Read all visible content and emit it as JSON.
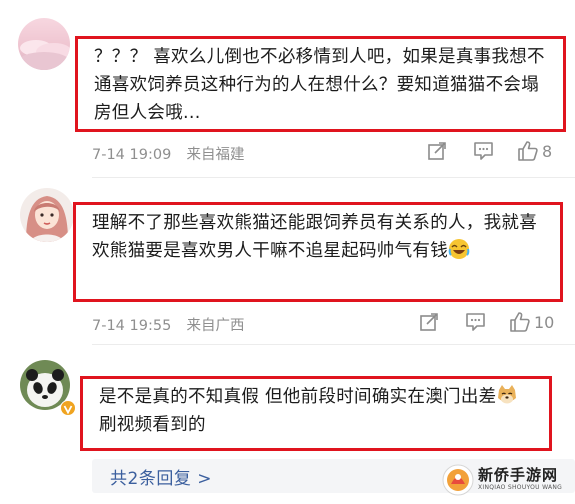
{
  "comments": [
    {
      "text": "？？？ 喜欢么儿倒也不必移情到人吧，如果是真事我想不通喜欢饲养员这种行为的人在想什么？要知道猫猫不会塌房但人会哦...",
      "time": "7-14 19:09",
      "location": "来自福建",
      "likes": "8"
    },
    {
      "text": "理解不了那些喜欢熊猫还能跟饲养员有关系的人，我就喜欢熊猫要是喜欢男人干嘛不追星起码帅气有钱",
      "time": "7-14 19:55",
      "location": "来自广西",
      "likes": "10"
    },
    {
      "text_part1": "是不是真的不知真假  但他前段时间确实在澳门出差",
      "text_part2": "刷视频看到的"
    }
  ],
  "replies_link": "共2条回复 >",
  "watermark_text": "新侨手游网",
  "watermark_sub": "XINQIAO SHOUYOU WANG",
  "colors": {
    "highlight_border": "#e0141e",
    "meta_gray": "#8f8f8f",
    "link_blue": "#3b5f9e",
    "replies_bg": "#f4f5f7"
  },
  "icons": [
    "share-icon",
    "comment-icon",
    "like-icon",
    "laugh-cry-emoji",
    "doge-emoji",
    "verified-badge-icon"
  ]
}
